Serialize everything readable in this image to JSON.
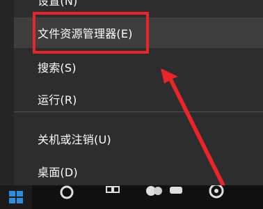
{
  "menu": {
    "items": [
      {
        "label": "设置(N)"
      },
      {
        "label": "文件资源管理器(E)"
      },
      {
        "label": "搜索(S)"
      },
      {
        "label": "运行(R)"
      },
      {
        "label": "关机或注销(U)"
      },
      {
        "label": "桌面(D)"
      }
    ]
  },
  "annotation": {
    "color": "#e8262a"
  },
  "icons": {
    "start": "windows-logo-icon",
    "search": "search-icon",
    "taskview": "task-view-icon"
  }
}
